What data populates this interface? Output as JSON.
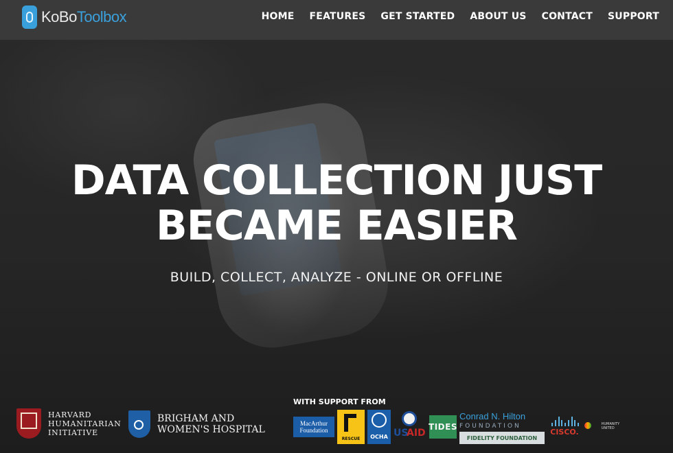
{
  "header": {
    "logo_kobo": "KoBo",
    "logo_toolbox": "Toolbox",
    "nav": [
      "HOME",
      "FEATURES",
      "GET STARTED",
      "ABOUT US",
      "CONTACT",
      "SUPPORT"
    ]
  },
  "hero": {
    "headline_line1": "DATA COLLECTION JUST",
    "headline_line2": "BECAME EASIER",
    "tagline": "BUILD, COLLECT, ANALYZE - ONLINE OR OFFLINE"
  },
  "partners": {
    "hhi": [
      "HARVARD",
      "HUMANITARIAN",
      "INITIATIVE"
    ],
    "bwh": [
      "BRIGHAM AND",
      "WOMEN'S HOSPITAL"
    ],
    "support_label": "WITH SUPPORT FROM",
    "macarthur": [
      "MacArthur",
      "Foundation"
    ],
    "rescue": "RESCUE",
    "ocha": "OCHA",
    "usaid_us": "US",
    "usaid_aid": "AID",
    "tides": "TIDES",
    "hilton": "Conrad N. Hilton",
    "hilton_foundation": "FOUNDATION",
    "fidelity": "FIDELITY FOUNDATION",
    "cisco": "CISCO.",
    "humanity": [
      "HUMANITY",
      "UNITED"
    ]
  },
  "colors": {
    "accent": "#3aa0db",
    "header_bg": "#3c3c3c"
  }
}
